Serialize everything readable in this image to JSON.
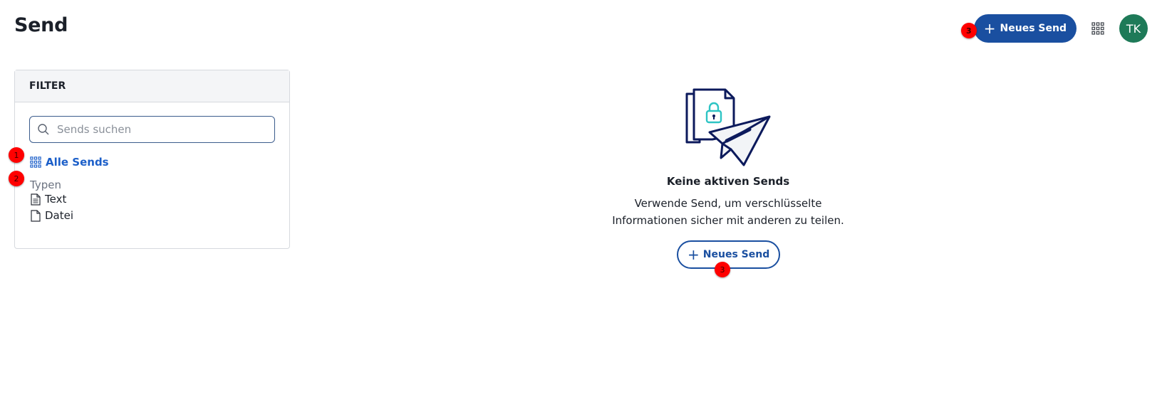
{
  "header": {
    "title": "Send",
    "new_send_label": "Neues Send",
    "avatar_initials": "TK"
  },
  "filter": {
    "heading": "FILTER",
    "search_placeholder": "Sends suchen",
    "search_value": "",
    "all_sends_label": "Alle Sends",
    "types_label": "Typen",
    "types": [
      {
        "label": "Text",
        "icon": "text-file-icon"
      },
      {
        "label": "Datei",
        "icon": "file-icon"
      }
    ]
  },
  "empty_state": {
    "title": "Keine aktiven Sends",
    "description": "Verwende Send, um verschlüsselte Informationen sicher mit anderen zu teilen.",
    "button_label": "Neues Send"
  },
  "markers": {
    "m1": "1",
    "m2": "2",
    "m3_header": "3",
    "m3_empty": "3"
  },
  "colors": {
    "primary": "#1a4fa0",
    "link": "#1c5fc9",
    "avatar": "#1e7a58",
    "marker": "#ff0000",
    "illustration_accent": "#2ec4c4",
    "illustration_stroke": "#0c1a5c"
  }
}
